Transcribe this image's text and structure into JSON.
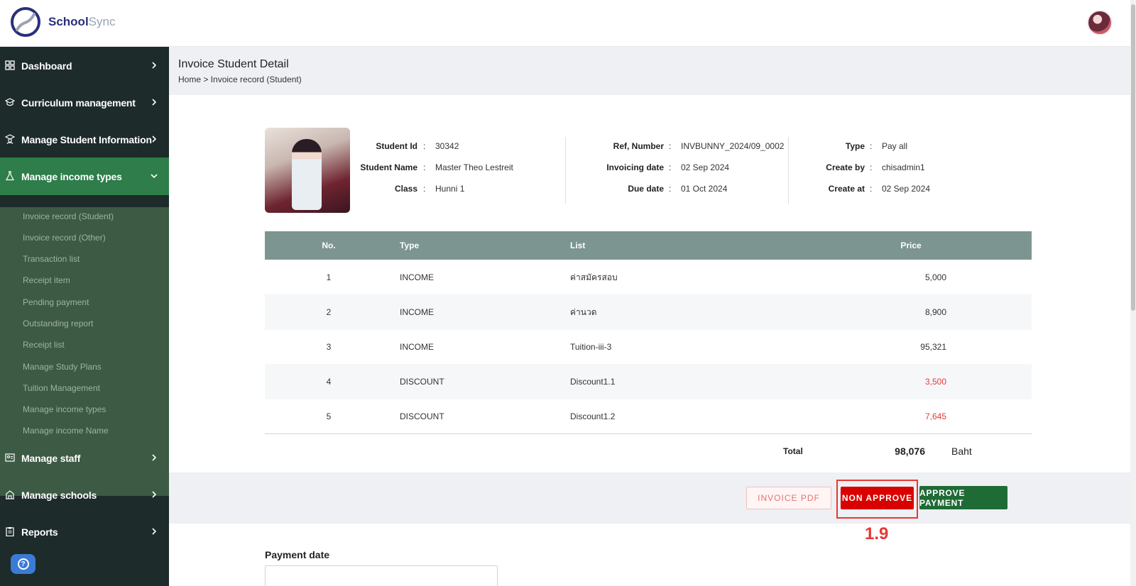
{
  "app": {
    "logo_primary": "School",
    "logo_secondary": "Sync"
  },
  "sidebar": {
    "items": [
      {
        "label": "Dashboard",
        "icon": "grid-icon"
      },
      {
        "label": "Curriculum management",
        "icon": "graduation-cap-icon"
      },
      {
        "label": "Manage Student Information",
        "icon": "student-icon"
      },
      {
        "label": "Manage income types",
        "icon": "flask-icon",
        "active": true
      },
      {
        "label": "Manage staff",
        "icon": "id-card-icon"
      },
      {
        "label": "Manage schools",
        "icon": "building-icon"
      },
      {
        "label": "Reports",
        "icon": "clipboard-icon"
      }
    ],
    "subitems": [
      "Invoice record (Student)",
      "Invoice record (Other)",
      "Transaction list",
      "Receipt item",
      "Pending payment",
      "Outstanding report",
      "Receipt list",
      "Manage Study Plans",
      "Tuition Management",
      "Manage income types",
      "Manage income Name"
    ]
  },
  "page": {
    "title": "Invoice Student Detail",
    "breadcrumb": "Home > Invoice record (Student)"
  },
  "student": {
    "id_label": "Student Id",
    "id": "30342",
    "name_label": "Student Name",
    "name": "Master Theo Lestreit",
    "class_label": "Class",
    "class": "Hunni 1"
  },
  "invoice": {
    "ref_label": "Ref, Number",
    "ref": "INVBUNNY_2024/09_0002",
    "inv_date_label": "Invoicing date",
    "inv_date": "02 Sep 2024",
    "due_label": "Due date",
    "due": "01 Oct 2024",
    "type_label": "Type",
    "type": "Pay all",
    "create_by_label": "Create by",
    "create_by": "chisadmin1",
    "create_at_label": "Create at",
    "create_at": "02 Sep 2024",
    "separator": ":"
  },
  "table": {
    "headers": {
      "no": "No.",
      "type": "Type",
      "list": "List",
      "price": "Price"
    },
    "rows": [
      {
        "no": "1",
        "type": "INCOME",
        "list": "ค่าสมัครสอบ",
        "price": "5,000",
        "negative": false
      },
      {
        "no": "2",
        "type": "INCOME",
        "list": "ค่านวด",
        "price": "8,900",
        "negative": false
      },
      {
        "no": "3",
        "type": "INCOME",
        "list": "Tuition-iii-3",
        "price": "95,321",
        "negative": false
      },
      {
        "no": "4",
        "type": "DISCOUNT",
        "list": "Discount1.1",
        "price": "3,500",
        "negative": true
      },
      {
        "no": "5",
        "type": "DISCOUNT",
        "list": "Discount1.2",
        "price": "7,645",
        "negative": true
      }
    ],
    "total_label": "Total",
    "total": "98,076",
    "currency": "Baht"
  },
  "actions": {
    "pdf": "INVOICE PDF",
    "non_approve": "NON APPROVE",
    "approve": "APPROVE PAYMENT",
    "step_annotation": "1.9"
  },
  "payment": {
    "date_label": "Payment date"
  },
  "colors": {
    "sidebar_bg": "#1d2b2a",
    "active_bg": "#2e7d4a",
    "submenu_bg": "#3c5a44",
    "table_header": "#7c9590",
    "danger": "#d90000",
    "approve": "#1f6b35",
    "negative_text": "#e53935"
  }
}
